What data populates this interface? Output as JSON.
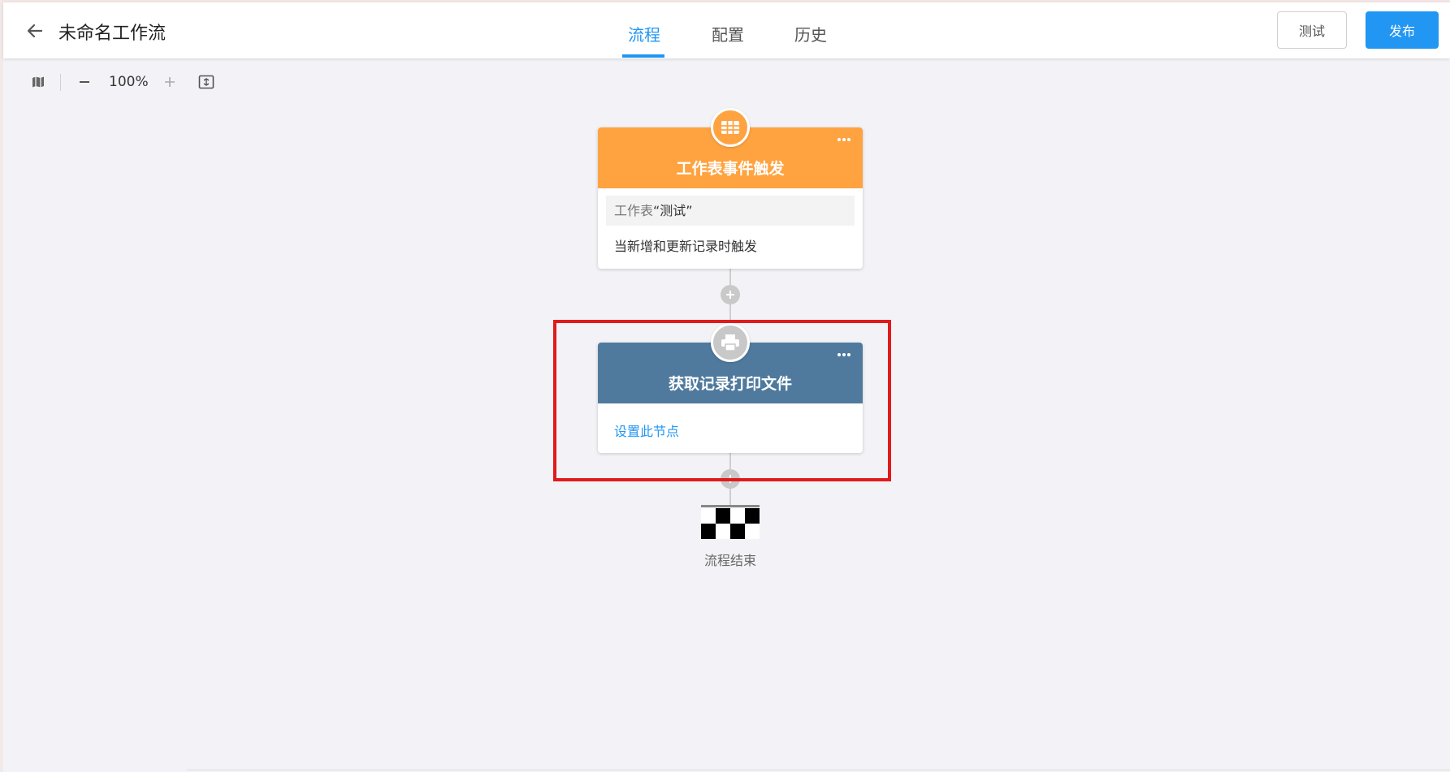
{
  "header": {
    "title": "未命名工作流",
    "tabs": [
      {
        "label": "流程",
        "active": true
      },
      {
        "label": "配置",
        "active": false
      },
      {
        "label": "历史",
        "active": false
      }
    ],
    "test_label": "测试",
    "publish_label": "发布"
  },
  "toolbar": {
    "zoom": "100%"
  },
  "nodes": {
    "trigger": {
      "title": "工作表事件触发",
      "sheet_prefix": "工作表",
      "sheet_name": "“测试”",
      "description": "当新增和更新记录时触发",
      "color": "#ffa340",
      "icon": "grid-table-icon"
    },
    "print": {
      "title": "获取记录打印文件",
      "setup_link": "设置此节点",
      "color": "#4f7a9e",
      "icon": "printer-icon"
    }
  },
  "end": {
    "label": "流程结束"
  },
  "colors": {
    "accent": "#2196f3",
    "highlight": "#e01b1b"
  }
}
